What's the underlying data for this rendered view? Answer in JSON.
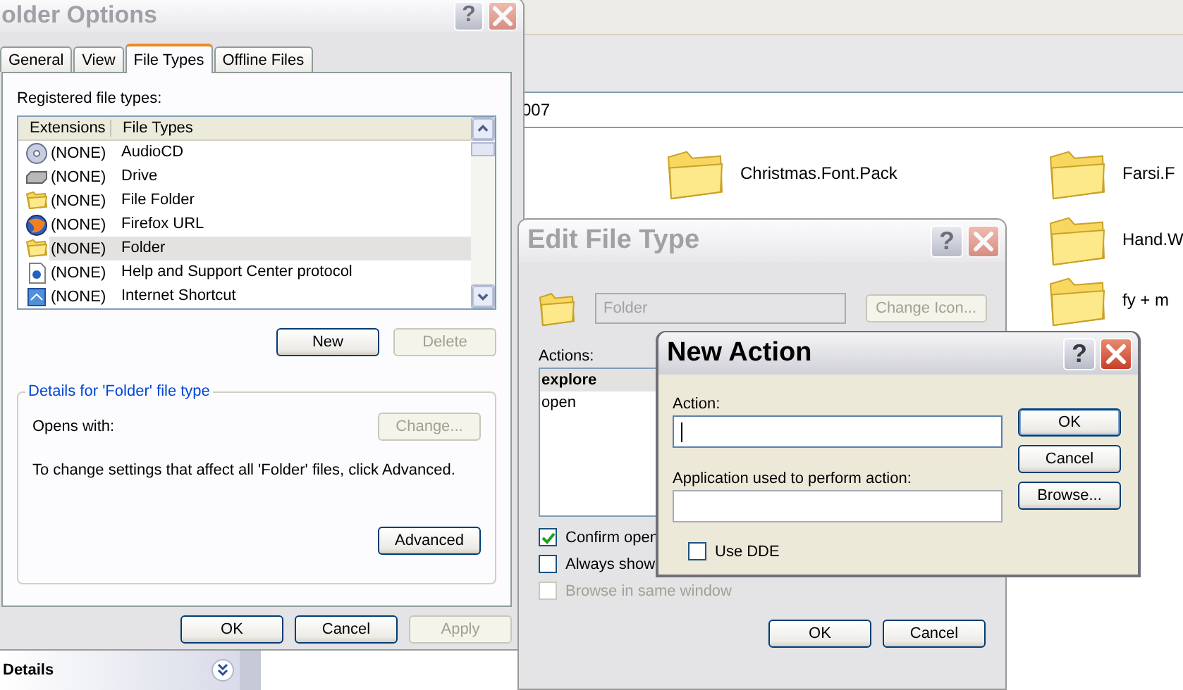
{
  "explorer": {
    "address": "007",
    "folders": [
      {
        "name": "Christmas.Font.Pack"
      },
      {
        "name": "Farsi.F"
      },
      {
        "name": "Hand.W"
      },
      {
        "name": "fy + m"
      }
    ],
    "details_panel": {
      "title": "Details"
    }
  },
  "folder_options": {
    "title": "older Options",
    "active": false,
    "help_button": "?",
    "tabs": [
      {
        "label": "General",
        "selected": false
      },
      {
        "label": "View",
        "selected": false
      },
      {
        "label": "File Types",
        "selected": true
      },
      {
        "label": "Offline Files",
        "selected": false
      }
    ],
    "list_label": "Registered file types:",
    "columns": [
      "Extensions",
      "File Types"
    ],
    "rows": [
      {
        "kind": "cd",
        "extension": "(NONE)",
        "type": "AudioCD",
        "selected": false
      },
      {
        "kind": "drive",
        "extension": "(NONE)",
        "type": "Drive",
        "selected": false
      },
      {
        "kind": "folder",
        "extension": "(NONE)",
        "type": "File Folder",
        "selected": false
      },
      {
        "kind": "globe",
        "extension": "(NONE)",
        "type": "Firefox URL",
        "selected": false
      },
      {
        "kind": "folder",
        "extension": "(NONE)",
        "type": "Folder",
        "selected": true
      },
      {
        "kind": "document",
        "extension": "(NONE)",
        "type": "Help and Support Center protocol",
        "selected": false
      },
      {
        "kind": "webpage",
        "extension": "(NONE)",
        "type": "Internet Shortcut",
        "selected": false
      }
    ],
    "list_buttons": [
      {
        "label": "New",
        "disabled": false
      },
      {
        "label": "Delete",
        "disabled": true
      }
    ],
    "details": {
      "title": "Details for 'Folder' file type",
      "opens_with": "Opens with:",
      "change_button": {
        "label": "Change...",
        "disabled": true
      },
      "text": "To change settings that affect all 'Folder' files, click Advanced.",
      "advanced_button": {
        "label": "Advanced",
        "disabled": false
      }
    },
    "buttons": [
      {
        "label": "OK",
        "disabled": false
      },
      {
        "label": "Cancel",
        "disabled": false
      },
      {
        "label": "Apply",
        "disabled": true
      }
    ]
  },
  "edit_file_type": {
    "title": "Edit File Type",
    "active": false,
    "help_button": "?",
    "name_value": "Folder",
    "change_icon_button": {
      "label": "Change Icon...",
      "disabled": true
    },
    "actions_label": "Actions:",
    "actions": [
      {
        "label": "explore",
        "default": true,
        "selected": true
      },
      {
        "label": "open",
        "default": false,
        "selected": false
      }
    ],
    "checkboxes": [
      {
        "label": "Confirm open",
        "checked": true,
        "disabled": false
      },
      {
        "label": "Always show",
        "checked": false,
        "disabled": false
      },
      {
        "label": "Browse in same window",
        "checked": false,
        "disabled": true
      }
    ],
    "buttons": [
      {
        "label": "OK",
        "disabled": false
      },
      {
        "label": "Cancel",
        "disabled": false
      }
    ]
  },
  "new_action": {
    "title": "New Action",
    "active": true,
    "help_button": "?",
    "fields": [
      {
        "label": "Action:",
        "focused": true
      },
      {
        "label": "Application used to perform action:",
        "focused": false
      }
    ],
    "buttons": [
      {
        "label": "OK",
        "default": true
      },
      {
        "label": "Cancel",
        "default": false
      },
      {
        "label": "Browse...",
        "default": false
      }
    ],
    "checkbox": {
      "label": "Use DDE",
      "checked": false
    }
  }
}
